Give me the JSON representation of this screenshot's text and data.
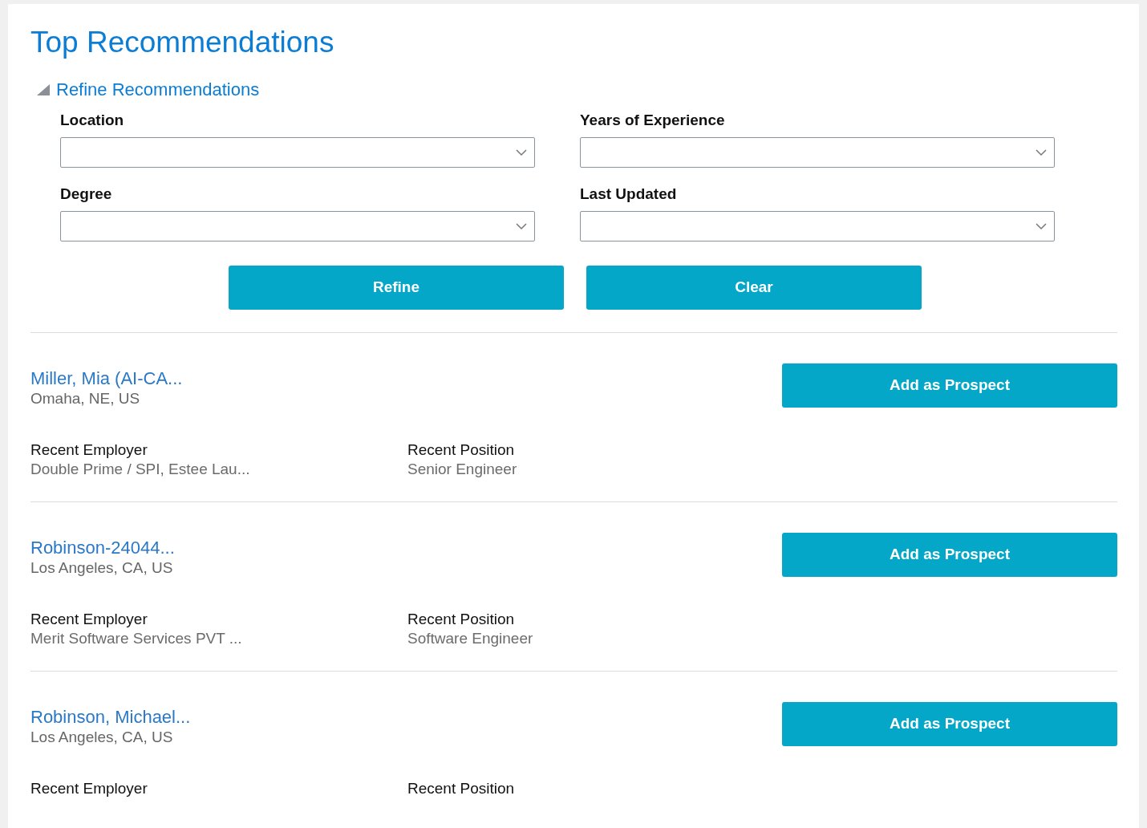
{
  "title": "Top Recommendations",
  "refine": {
    "label": "Refine Recommendations",
    "expanded": true,
    "filters": [
      {
        "label": "Location"
      },
      {
        "label": "Years of Experience"
      },
      {
        "label": "Degree"
      },
      {
        "label": "Last Updated"
      }
    ],
    "buttons": [
      "Refine",
      "Clear"
    ]
  },
  "candidates": [
    {
      "name": "Miller, Mia (AI-CA...",
      "location": "Omaha, NE, US",
      "action": "Add as Prospect",
      "employer_label": "Recent Employer",
      "employer": "Double Prime / SPI, Estee Lau...",
      "position_label": "Recent Position",
      "position": "Senior Engineer"
    },
    {
      "name": "Robinson-24044...",
      "location": "Los Angeles, CA, US",
      "action": "Add as Prospect",
      "employer_label": "Recent Employer",
      "employer": "Merit Software Services PVT ...",
      "position_label": "Recent Position",
      "position": "Software Engineer"
    },
    {
      "name": "Robinson, Michael...",
      "location": "Los Angeles, CA, US",
      "action": "Add as Prospect",
      "employer_label": "Recent Employer",
      "position_label": "Recent Position"
    }
  ]
}
